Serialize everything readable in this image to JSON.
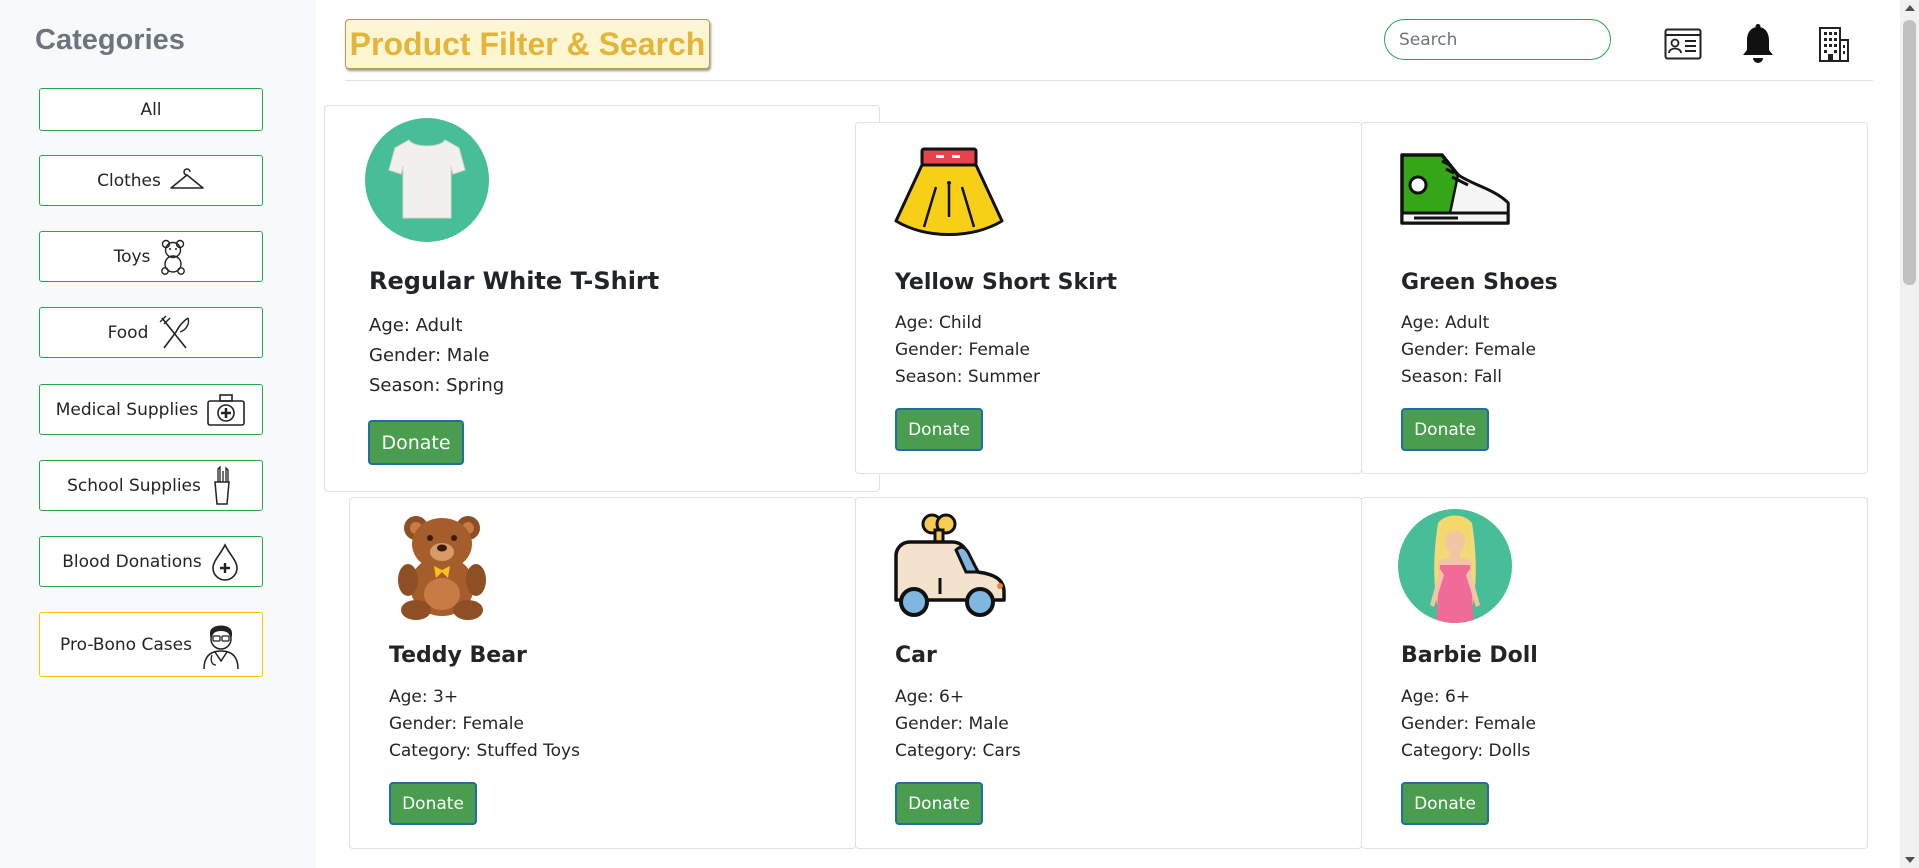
{
  "sidebar": {
    "title": "Categories",
    "items": [
      {
        "label": "All",
        "icon": ""
      },
      {
        "label": "Clothes",
        "icon": "hanger-icon"
      },
      {
        "label": "Toys",
        "icon": "teddy-bear-icon"
      },
      {
        "label": "Food",
        "icon": "fork-knife-icon"
      },
      {
        "label": "Medical Supplies",
        "icon": "first-aid-kit-icon"
      },
      {
        "label": "School Supplies",
        "icon": "pencil-cup-icon"
      },
      {
        "label": "Blood Donations",
        "icon": "blood-drop-plus-icon"
      },
      {
        "label": "Pro-Bono Cases",
        "icon": "doctor-icon"
      }
    ]
  },
  "header": {
    "brand": "Product Filter & Search",
    "search_placeholder": "Search",
    "icons": [
      "id-card-icon",
      "bell-icon",
      "building-icon"
    ]
  },
  "products": [
    {
      "name": "Regular White T-Shirt",
      "attrs": [
        "Age: Adult",
        "Gender: Male",
        "Season: Spring"
      ],
      "button": "Donate",
      "image": "tshirt-image"
    },
    {
      "name": "Yellow Short Skirt",
      "attrs": [
        "Age: Child",
        "Gender: Female",
        "Season: Summer"
      ],
      "button": "Donate",
      "image": "skirt-image"
    },
    {
      "name": "Green Shoes",
      "attrs": [
        "Age: Adult",
        "Gender: Female",
        "Season: Fall"
      ],
      "button": "Donate",
      "image": "shoe-image"
    },
    {
      "name": "Teddy Bear",
      "attrs": [
        "Age: 3+",
        "Gender: Female",
        "Category: Stuffed Toys"
      ],
      "button": "Donate",
      "image": "teddy-bear-image"
    },
    {
      "name": "Car",
      "attrs": [
        "Age: 6+",
        "Gender: Male",
        "Category: Cars"
      ],
      "button": "Donate",
      "image": "toy-car-image"
    },
    {
      "name": "Barbie Doll",
      "attrs": [
        "Age: 6+",
        "Gender: Female",
        "Category: Dolls"
      ],
      "button": "Donate",
      "image": "doll-image"
    }
  ],
  "colors": {
    "accent_green": "#28a745",
    "donate_green": "#4a9d4e",
    "brand_yellow": "#e5b53a",
    "pro_bono_border": "#ffc107"
  }
}
